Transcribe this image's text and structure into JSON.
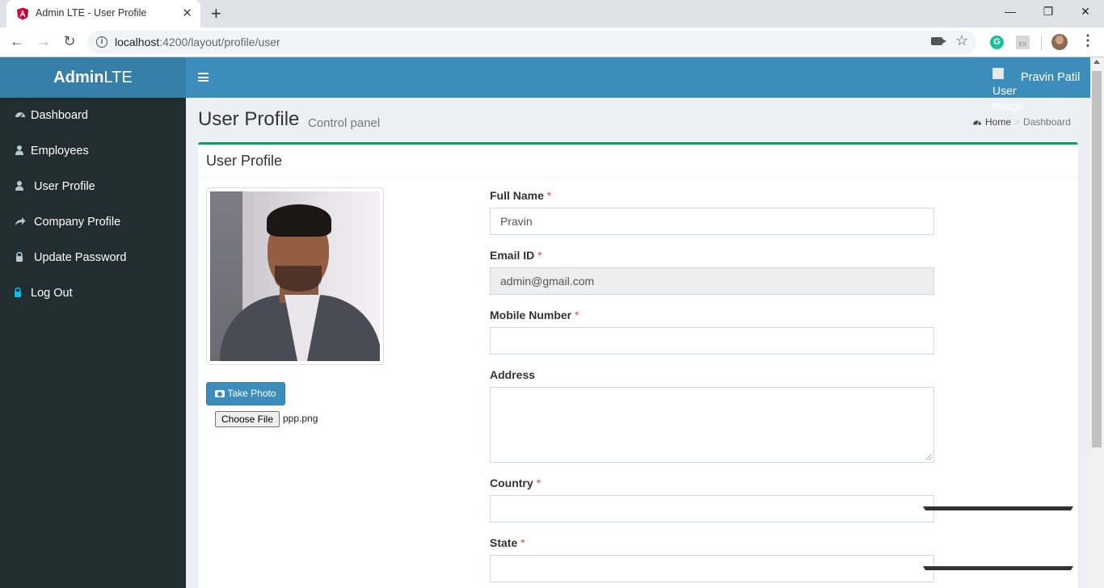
{
  "browser": {
    "tab_title": "Admin LTE - User Profile",
    "new_tab": "+",
    "url_host": "localhost",
    "url_path": ":4200/layout/profile/user",
    "ext_grammarly": "G",
    "ext_es": "ES"
  },
  "header": {
    "logo_bold": "Admin",
    "logo_light": "LTE",
    "user_image_alt": "User Image",
    "user_name": "Pravin Patil"
  },
  "sidebar": {
    "items": [
      {
        "label": "Dashboard",
        "icon": "dashboard-icon"
      },
      {
        "label": "Employees",
        "icon": "user-icon"
      },
      {
        "label": "User Profile",
        "icon": "user-icon"
      },
      {
        "label": "Company Profile",
        "icon": "share-icon"
      },
      {
        "label": "Update Password",
        "icon": "lock-icon"
      },
      {
        "label": "Log Out",
        "icon": "lock-icon"
      }
    ]
  },
  "content": {
    "title": "User Profile",
    "subtitle": "Control panel",
    "breadcrumb": {
      "home": "Home",
      "current": "Dashboard"
    }
  },
  "profile_box": {
    "title": "User Profile",
    "take_photo": "Take Photo",
    "choose_file": "Choose File",
    "file_name": "ppp.png",
    "fields": {
      "full_name": {
        "label": "Full Name",
        "value": "Pravin"
      },
      "email": {
        "label": "Email ID",
        "value": "admin@gmail.com"
      },
      "mobile": {
        "label": "Mobile Number",
        "value": ""
      },
      "address": {
        "label": "Address",
        "value": ""
      },
      "country": {
        "label": "Country",
        "value": ""
      },
      "state": {
        "label": "State",
        "value": ""
      }
    },
    "required_mark": "*"
  },
  "colors": {
    "logo_bg": "#367fa9",
    "navbar_bg": "#3c8dbc",
    "sidebar_bg": "#222d32",
    "box_accent": "#00a65a",
    "required": "#dd4b39"
  }
}
